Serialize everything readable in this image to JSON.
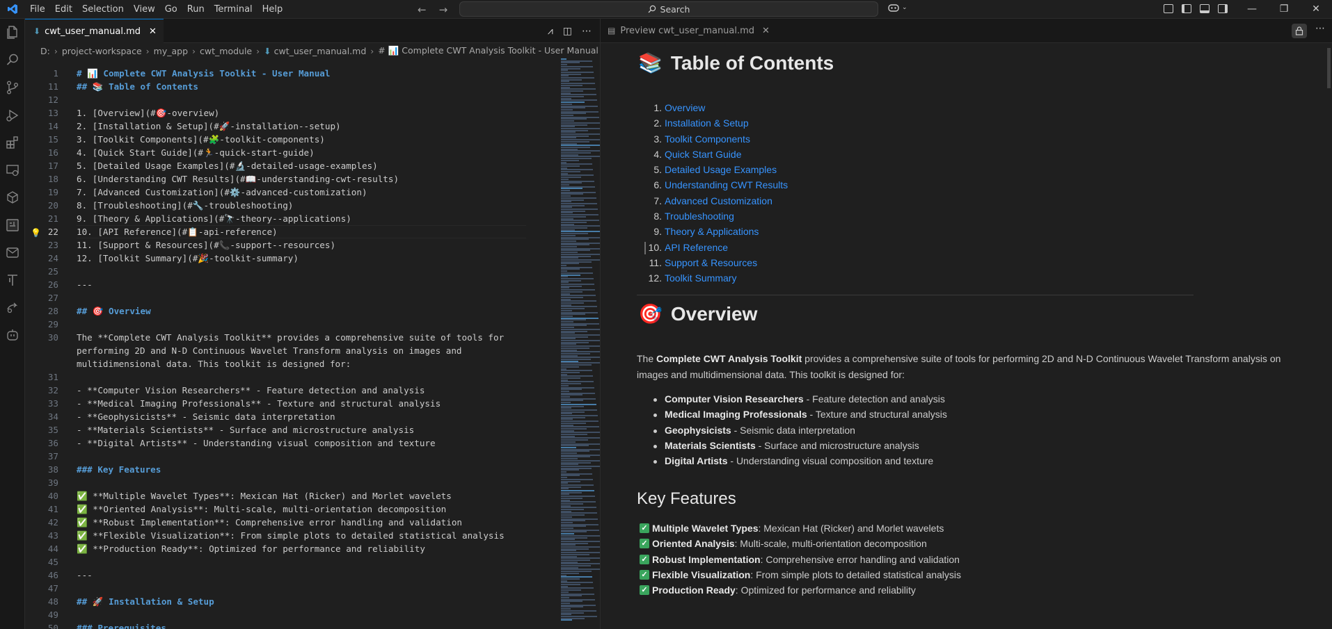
{
  "menu": [
    "File",
    "Edit",
    "Selection",
    "View",
    "Go",
    "Run",
    "Terminal",
    "Help"
  ],
  "search": {
    "label": "Search"
  },
  "window_controls": [
    "—",
    "❐",
    "✕"
  ],
  "editor": {
    "tab": {
      "label": "cwt_user_manual.md"
    },
    "breadcrumbs": [
      "D:",
      "project-workspace",
      "my_app",
      "cwt_module",
      "cwt_user_manual.md",
      "# 📊 Complete CWT Analysis Toolkit - User Manual"
    ],
    "lines": [
      {
        "n": "1",
        "t": "# 📊 Complete CWT Analysis Toolkit - User Manual",
        "k": "h"
      },
      {
        "n": "11",
        "t": "## 📚 Table of Contents",
        "k": "h"
      },
      {
        "n": "12",
        "t": "",
        "k": ""
      },
      {
        "n": "13",
        "t": "1. [Overview](#🎯-overview)",
        "k": "l"
      },
      {
        "n": "14",
        "t": "2. [Installation & Setup](#🚀-installation--setup)",
        "k": "l"
      },
      {
        "n": "15",
        "t": "3. [Toolkit Components](#🧩-toolkit-components)",
        "k": "l"
      },
      {
        "n": "16",
        "t": "4. [Quick Start Guide](#🏃-quick-start-guide)",
        "k": "l"
      },
      {
        "n": "17",
        "t": "5. [Detailed Usage Examples](#🔬-detailed-usage-examples)",
        "k": "l"
      },
      {
        "n": "18",
        "t": "6. [Understanding CWT Results](#📖-understanding-cwt-results)",
        "k": "l"
      },
      {
        "n": "19",
        "t": "7. [Advanced Customization](#⚙️-advanced-customization)",
        "k": "l"
      },
      {
        "n": "20",
        "t": "8. [Troubleshooting](#🔧-troubleshooting)",
        "k": "l"
      },
      {
        "n": "21",
        "t": "9. [Theory & Applications](#🔭-theory--applications)",
        "k": "l"
      },
      {
        "n": "22",
        "t": "10. [API Reference](#📋-api-reference)",
        "k": "l"
      },
      {
        "n": "23",
        "t": "11. [Support & Resources](#📞-support--resources)",
        "k": "l"
      },
      {
        "n": "24",
        "t": "12. [Toolkit Summary](#🎉-toolkit-summary)",
        "k": "l"
      },
      {
        "n": "25",
        "t": "",
        "k": ""
      },
      {
        "n": "26",
        "t": "---",
        "k": ""
      },
      {
        "n": "27",
        "t": "",
        "k": ""
      },
      {
        "n": "28",
        "t": "## 🎯 Overview",
        "k": "h"
      },
      {
        "n": "29",
        "t": "",
        "k": ""
      },
      {
        "n": "30",
        "t": "The **Complete CWT Analysis Toolkit** provides a comprehensive suite of tools for",
        "k": "p"
      },
      {
        "n": "",
        "t": "performing 2D and N-D Continuous Wavelet Transform analysis on images and",
        "k": ""
      },
      {
        "n": "",
        "t": "multidimensional data. This toolkit is designed for:",
        "k": ""
      },
      {
        "n": "31",
        "t": "",
        "k": ""
      },
      {
        "n": "32",
        "t": "- **Computer Vision Researchers** - Feature detection and analysis",
        "k": "p"
      },
      {
        "n": "33",
        "t": "- **Medical Imaging Professionals** - Texture and structural analysis",
        "k": "p"
      },
      {
        "n": "34",
        "t": "- **Geophysicists** - Seismic data interpretation",
        "k": "p"
      },
      {
        "n": "35",
        "t": "- **Materials Scientists** - Surface and microstructure analysis",
        "k": "p"
      },
      {
        "n": "36",
        "t": "- **Digital Artists** - Understanding visual composition and texture",
        "k": "p"
      },
      {
        "n": "37",
        "t": "",
        "k": ""
      },
      {
        "n": "38",
        "t": "### Key Features",
        "k": "h"
      },
      {
        "n": "39",
        "t": "",
        "k": ""
      },
      {
        "n": "40",
        "t": "✅ **Multiple Wavelet Types**: Mexican Hat (Ricker) and Morlet wavelets",
        "k": "p"
      },
      {
        "n": "41",
        "t": "✅ **Oriented Analysis**: Multi-scale, multi-orientation decomposition",
        "k": "p"
      },
      {
        "n": "42",
        "t": "✅ **Robust Implementation**: Comprehensive error handling and validation",
        "k": "p"
      },
      {
        "n": "43",
        "t": "✅ **Flexible Visualization**: From simple plots to detailed statistical analysis",
        "k": "p"
      },
      {
        "n": "44",
        "t": "✅ **Production Ready**: Optimized for performance and reliability",
        "k": "p"
      },
      {
        "n": "45",
        "t": "",
        "k": ""
      },
      {
        "n": "46",
        "t": "---",
        "k": ""
      },
      {
        "n": "47",
        "t": "",
        "k": ""
      },
      {
        "n": "48",
        "t": "## 🚀 Installation & Setup",
        "k": "h"
      },
      {
        "n": "49",
        "t": "",
        "k": ""
      },
      {
        "n": "50",
        "t": "### Prerequisites",
        "k": "h"
      }
    ]
  },
  "preview": {
    "tab": {
      "label": "Preview cwt_user_manual.md"
    },
    "toc_heading": "Table of Contents",
    "toc_emoji": "📚",
    "toc": [
      {
        "num": "1.",
        "label": "Overview"
      },
      {
        "num": "2.",
        "label": "Installation & Setup"
      },
      {
        "num": "3.",
        "label": "Toolkit Components"
      },
      {
        "num": "4.",
        "label": "Quick Start Guide"
      },
      {
        "num": "5.",
        "label": "Detailed Usage Examples"
      },
      {
        "num": "6.",
        "label": "Understanding CWT Results"
      },
      {
        "num": "7.",
        "label": "Advanced Customization"
      },
      {
        "num": "8.",
        "label": "Troubleshooting"
      },
      {
        "num": "9.",
        "label": "Theory & Applications"
      },
      {
        "num": "10.",
        "label": "API Reference"
      },
      {
        "num": "11.",
        "label": "Support & Resources"
      },
      {
        "num": "12.",
        "label": "Toolkit Summary"
      }
    ],
    "overview_heading": "Overview",
    "overview_emoji": "🎯",
    "overview_text": {
      "pre": "The ",
      "bold": "Complete CWT Analysis Toolkit",
      "post": " provides a comprehensive suite of tools for performing 2D and N-D Continuous Wavelet Transform analysis on images and multidimensional data. This toolkit is designed for:"
    },
    "audiences": [
      {
        "bold": "Computer Vision Researchers",
        "rest": " - Feature detection and analysis"
      },
      {
        "bold": "Medical Imaging Professionals",
        "rest": " - Texture and structural analysis"
      },
      {
        "bold": "Geophysicists",
        "rest": " - Seismic data interpretation"
      },
      {
        "bold": "Materials Scientists",
        "rest": " - Surface and microstructure analysis"
      },
      {
        "bold": "Digital Artists",
        "rest": " - Understanding visual composition and texture"
      }
    ],
    "features_heading": "Key Features",
    "features": [
      {
        "bold": "Multiple Wavelet Types",
        "rest": ": Mexican Hat (Ricker) and Morlet wavelets"
      },
      {
        "bold": "Oriented Analysis",
        "rest": ": Multi-scale, multi-orientation decomposition"
      },
      {
        "bold": "Robust Implementation",
        "rest": ": Comprehensive error handling and validation"
      },
      {
        "bold": "Flexible Visualization",
        "rest": ": From simple plots to detailed statistical analysis"
      },
      {
        "bold": "Production Ready",
        "rest": ": Optimized for performance and reliability"
      }
    ]
  },
  "colors": {
    "accent": "#0078d4",
    "link": "#3794ff",
    "heading_md": "#569cd6",
    "check": "#3aa55d"
  }
}
